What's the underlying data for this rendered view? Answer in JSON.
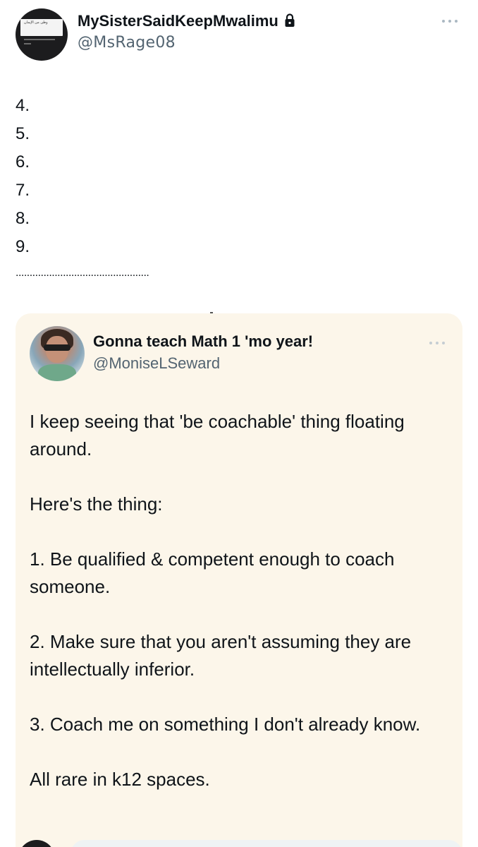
{
  "post": {
    "author": {
      "display_name": "MySisterSaidKeepMwalimu",
      "handle": "@MsRage08",
      "avatar_banner_text": "وطن من الإيمان",
      "protected_icon": "lock-icon"
    },
    "more_icon": "more-horizontal-icon",
    "list_lines": [
      "4.",
      "5.",
      "6.",
      "7.",
      "8.",
      "9."
    ],
    "divider": "................................................"
  },
  "quoted_post": {
    "author": {
      "display_name": "Gonna teach Math 1 'mo year!",
      "handle": "@MoniseLSeward"
    },
    "more_icon": "more-horizontal-icon",
    "paragraphs": [
      "I keep seeing that 'be coachable' thing floating around.",
      "Here's the thing:",
      "1. Be qualified & competent enough to coach someone.",
      "2. Make sure that you aren't assuming they are intellectually inferior.",
      "3. Coach me on something I don't already know.",
      "All rare in k12 spaces."
    ],
    "background": "#fcf6ea"
  },
  "colors": {
    "text_primary": "#0f1419",
    "text_secondary": "#536471",
    "reply_bar": "#eff3f4"
  }
}
